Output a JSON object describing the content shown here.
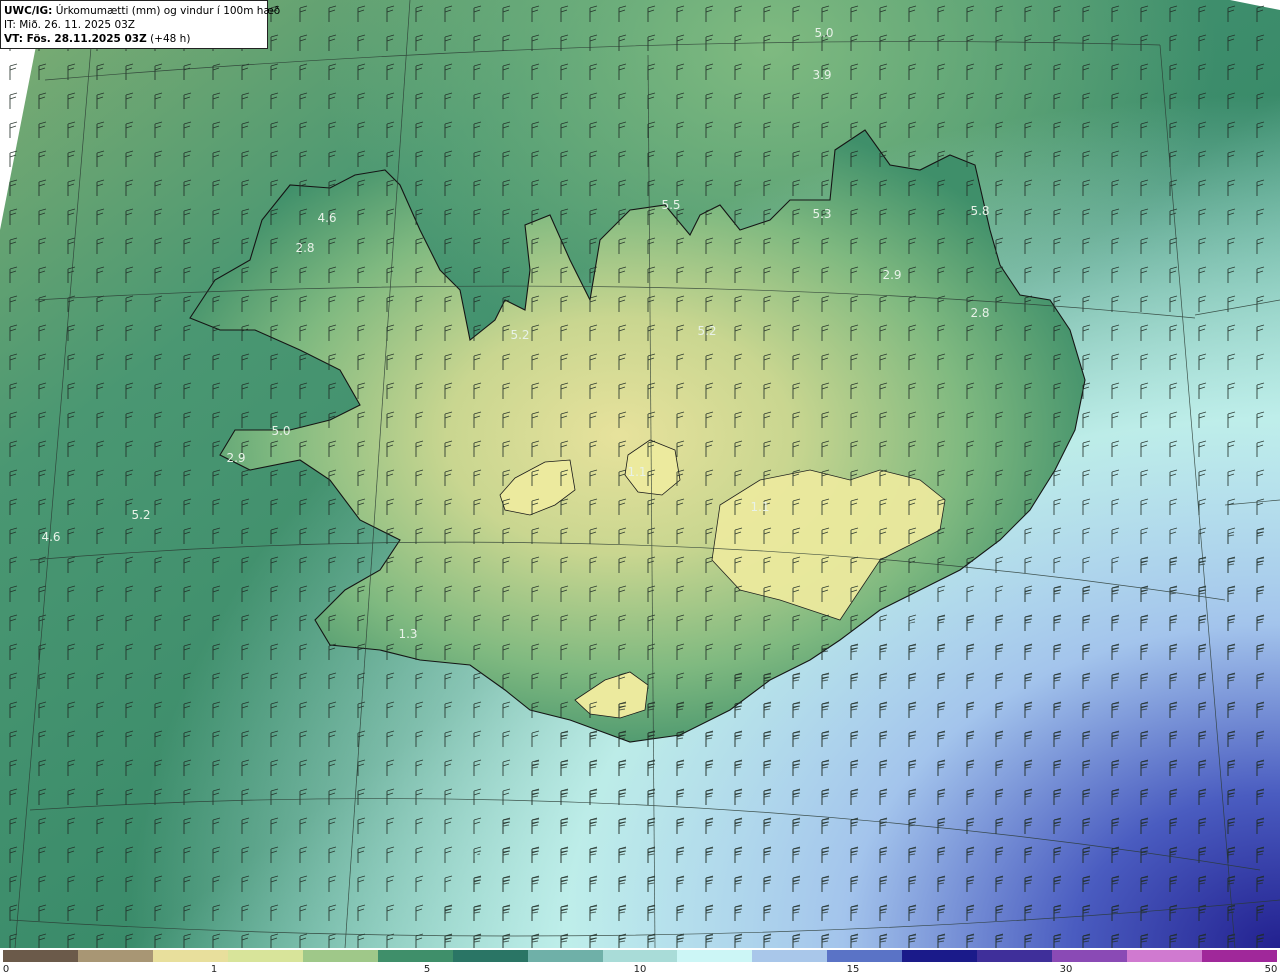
{
  "legend": {
    "model_label": "UWC/IG:",
    "field_label": "Úrkomumætti (mm) og vindur í 100m hæð",
    "issue_time": "IT: Mið. 26. 11. 2025 03Z",
    "valid_label": "VT: Fös. 28.11.2025 03Z",
    "valid_lead": "(+48 h)"
  },
  "value_labels": [
    {
      "text": "5.0"
    },
    {
      "text": "3.9"
    },
    {
      "text": "5.5"
    },
    {
      "text": "5.3"
    },
    {
      "text": "5.8"
    },
    {
      "text": "4.6"
    },
    {
      "text": "2.8"
    },
    {
      "text": "2.9"
    },
    {
      "text": "2.8"
    },
    {
      "text": "5.2"
    },
    {
      "text": "5.2"
    },
    {
      "text": "5.0"
    },
    {
      "text": "2.9"
    },
    {
      "text": "5.2"
    },
    {
      "text": "4.6"
    },
    {
      "text": "1.1"
    },
    {
      "text": "1.1"
    },
    {
      "text": "1.3"
    }
  ],
  "colorbar": {
    "ticks": [
      "0",
      "1",
      "5",
      "10",
      "15",
      "30",
      "50"
    ],
    "colors": [
      "#6b5a4a",
      "#a89674",
      "#e8df9c",
      "#d8e49a",
      "#9fc889",
      "#3f8f6a",
      "#2a7565",
      "#6fb0a8",
      "#a9dcd8",
      "#ccf6f6",
      "#a9c7ea",
      "#5a73c6",
      "#1a1a8a",
      "#3f2f9a",
      "#8a4ab5",
      "#d07ad0",
      "#a0289a"
    ]
  },
  "colors": {
    "sea": "#3f8f6a",
    "land_low": "#5aa27a",
    "land_high": "#e3e09a",
    "south_sea": "#bff0ec",
    "deep": "#1a1a8a",
    "coast": "#1a1a1a",
    "label": "#e8f2e8"
  },
  "icons": [
    "wind-barb-icon"
  ]
}
